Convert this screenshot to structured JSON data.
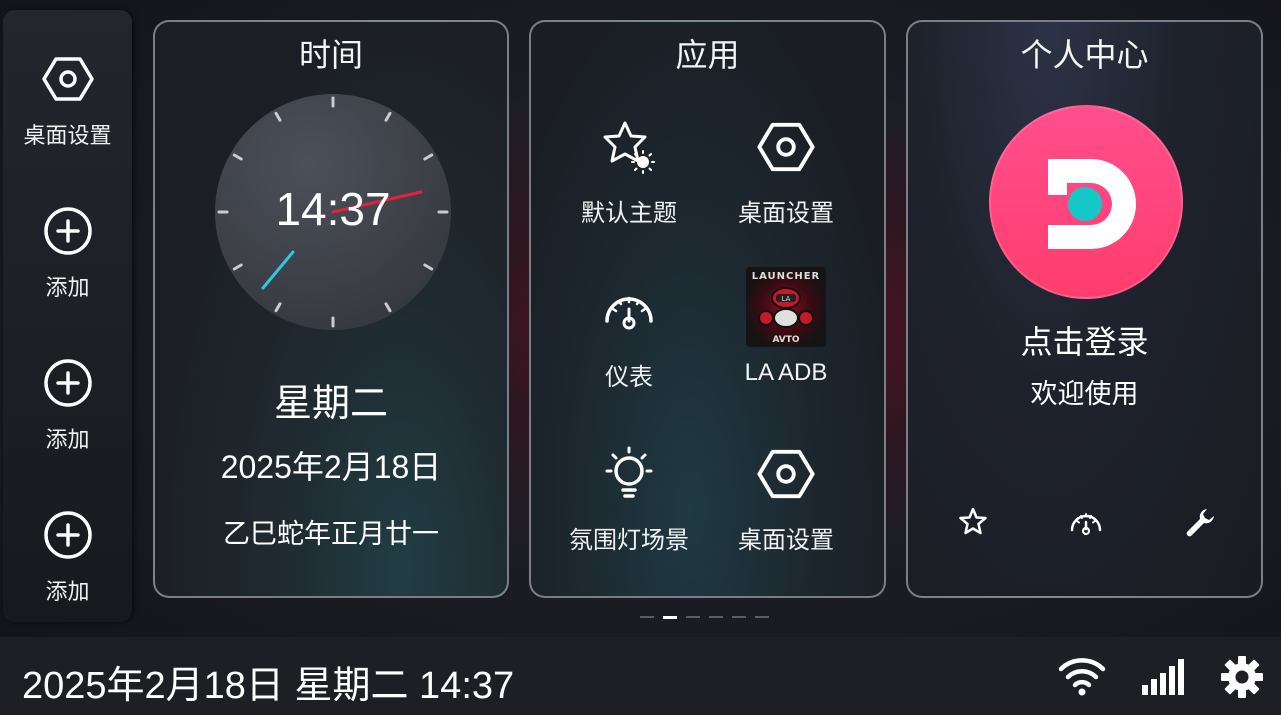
{
  "sidebar": {
    "items": [
      {
        "label": "桌面设置",
        "icon": "hex-nut-icon"
      },
      {
        "label": "添加",
        "icon": "plus-circle-icon"
      },
      {
        "label": "添加",
        "icon": "plus-circle-icon"
      },
      {
        "label": "添加",
        "icon": "plus-circle-icon"
      }
    ]
  },
  "time_card": {
    "title": "时间",
    "clock_time": "14:37",
    "weekday": "星期二",
    "date": "2025年2月18日",
    "lunar": "乙巳蛇年正月廿一"
  },
  "apps_card": {
    "title": "应用",
    "apps": [
      {
        "label": "默认主题",
        "icon": "star-theme-icon"
      },
      {
        "label": "桌面设置",
        "icon": "hex-nut-icon"
      },
      {
        "label": "仪表",
        "icon": "gauge-icon"
      },
      {
        "label": "LA ADB",
        "icon": "launcher-la-logo",
        "logo_top": "LAUNCHER",
        "logo_bottom": "AVTO"
      },
      {
        "label": "氛围灯场景",
        "icon": "light-bulb-icon"
      },
      {
        "label": "桌面设置",
        "icon": "hex-nut-icon"
      }
    ]
  },
  "user_card": {
    "title": "个人中心",
    "login": "点击登录",
    "welcome": "欢迎使用",
    "shortcuts": [
      "star-icon",
      "gauge-icon",
      "wrench-icon"
    ]
  },
  "pager": {
    "count": 6,
    "active": 1
  },
  "statusbar": {
    "datetime": "2025年2月18日 星期二 14:37",
    "icons": [
      "wifi-icon",
      "signal-icon",
      "settings-gear-icon"
    ]
  },
  "colors": {
    "avatar": "#ff4e8d",
    "avatar_dot": "#14c8c8",
    "second_hand": "#e8203a",
    "minute_hand": "#2ec8e0"
  }
}
